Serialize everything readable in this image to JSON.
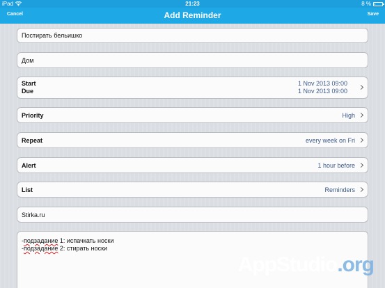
{
  "status_bar": {
    "device": "iPad",
    "time": "21:23",
    "battery": "8 %"
  },
  "nav": {
    "cancel_label": "Cancel",
    "title": "Add Reminder",
    "save_label": "Save"
  },
  "fields": {
    "title": "Постирать бельишко",
    "location": "Дом",
    "start_label": "Start",
    "start_value": "1 Nov 2013 09:00",
    "due_label": "Due",
    "due_value": "1 Nov 2013 09:00",
    "priority_label": "Priority",
    "priority_value": "High",
    "repeat_label": "Repeat",
    "repeat_value": "every week on Fri",
    "alert_label": "Alert",
    "alert_value": "1 hour before",
    "list_label": "List",
    "list_value": "Reminders",
    "url": "Stirka.ru",
    "notes": {
      "line1_prefix": "-",
      "line1_word": "подзадание",
      "line1_rest": " 1: испачкать носки",
      "line2_prefix": "-",
      "line2_word": "подзадание",
      "line2_rest": " 2: стирать носки"
    }
  },
  "watermark": {
    "app": "AppStudio",
    "org": ".org"
  },
  "colors": {
    "nav_bar": "#1ea8e6",
    "value_text": "#3d5b8a"
  }
}
